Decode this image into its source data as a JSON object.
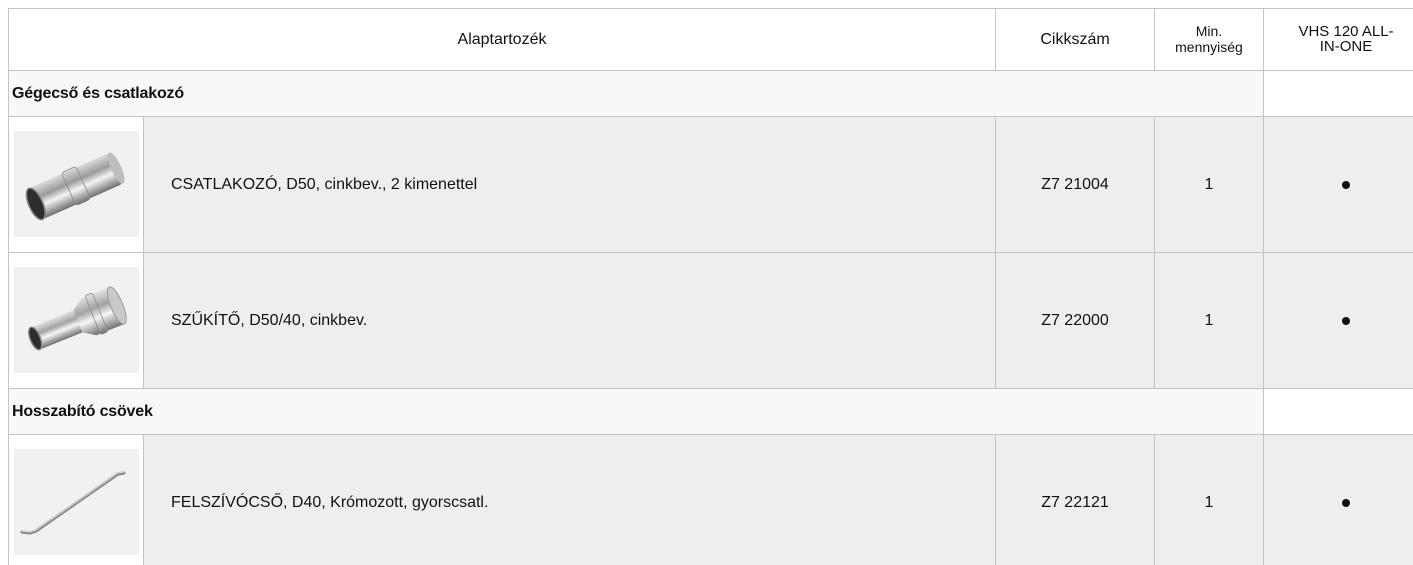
{
  "header": {
    "col_main": "Alaptartozék",
    "col_code": "Cikkszám",
    "col_min_line1": "Min.",
    "col_min_line2": "mennyiség",
    "col_vhs_line1": "VHS 120 ALL-",
    "col_vhs_line2": "IN-ONE"
  },
  "groups": [
    {
      "title": "Gégecső és csatlakozó",
      "items": [
        {
          "icon": "connector-pipe-icon",
          "description": "CSATLAKOZÓ, D50, cinkbev., 2 kimenettel",
          "code": "Z7 21004",
          "min_qty": "1",
          "vhs": "•"
        },
        {
          "icon": "reducer-pipe-icon",
          "description": "SZŰKÍTŐ, D50/40, cinkbev.",
          "code": "Z7 22000",
          "min_qty": "1",
          "vhs": "•"
        }
      ]
    },
    {
      "title": "Hosszabító csövek",
      "items": [
        {
          "icon": "suction-tube-icon",
          "description": "FELSZÍVÓCSŐ, D40, Krómozott, gyorscsatl.",
          "code": "Z7 22121",
          "min_qty": "1",
          "vhs": "•"
        }
      ]
    }
  ]
}
